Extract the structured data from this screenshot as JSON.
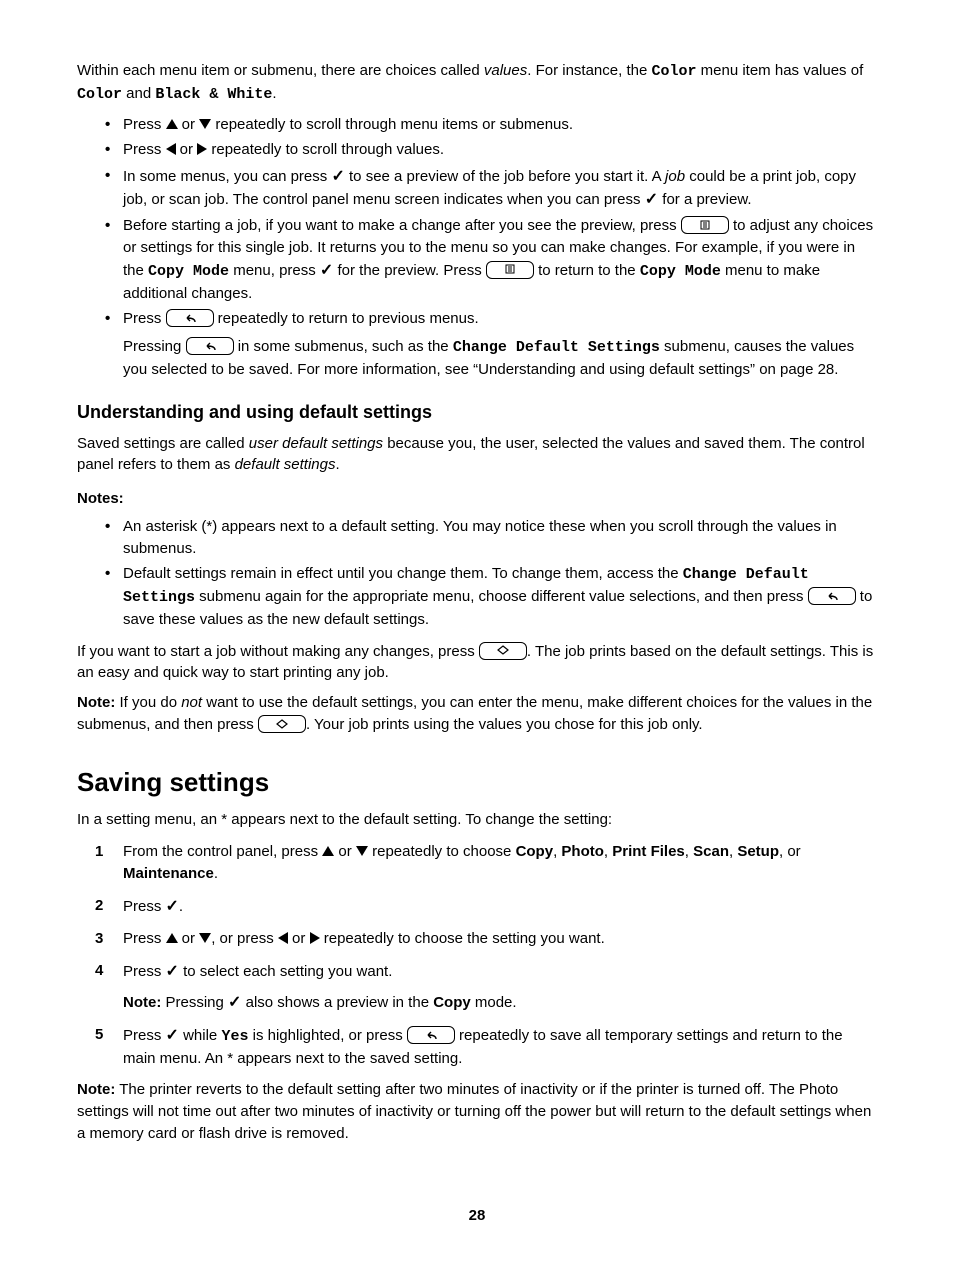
{
  "intro": {
    "p1a": "Within each menu item or submenu, there are choices called ",
    "p1b": "values",
    "p1c": ". For instance, the ",
    "p1d": "Color",
    "p1e": " menu item has values of ",
    "p1f": "Color",
    "p1g": " and ",
    "p1h": "Black & White",
    "p1i": "."
  },
  "bullets1": {
    "b1a": "Press ",
    "b1b": " or ",
    "b1c": " repeatedly to scroll through menu items or submenus.",
    "b2a": "Press ",
    "b2b": " or ",
    "b2c": " repeatedly to scroll through values.",
    "b3a": "In some menus, you can press ",
    "b3b": " to see a preview of the job before you start it. A ",
    "b3c": "job",
    "b3d": " could be a print job, copy job, or scan job. The control panel menu screen indicates when you can press ",
    "b3e": " for a preview.",
    "b4a": "Before starting a job, if you want to make a change after you see the preview, press ",
    "b4b": " to adjust any choices or settings for this single job. It returns you to the menu so you can make changes. For example, if you were in the ",
    "b4c": "Copy Mode",
    "b4d": " menu, press ",
    "b4e": " for the preview. Press ",
    "b4f": " to return to the ",
    "b4g": "Copy Mode",
    "b4h": " menu to make additional changes.",
    "b5a": "Press ",
    "b5b": " repeatedly to return to previous menus.",
    "b5c": "Pressing ",
    "b5d": " in some submenus, such as the ",
    "b5e": "Change Default Settings",
    "b5f": " submenu, causes the values you selected to be saved. For more information, see “Understanding and using default settings” on page 28."
  },
  "heading_defaults": "Understanding and using default settings",
  "defaults": {
    "p1a": "Saved settings are called ",
    "p1b": "user default settings",
    "p1c": " because you, the user, selected the values and saved them. The control panel refers to them as ",
    "p1d": "default settings",
    "p1e": "."
  },
  "notes_label": "Notes:",
  "notes": {
    "n1": "An asterisk (*) appears next to a default setting. You may notice these when you scroll through the values in submenus.",
    "n2a": "Default settings remain in effect until you change them. To change them, access the ",
    "n2b": "Change Default Settings",
    "n2c": " submenu again for the appropriate menu, choose different value selections, and then press ",
    "n2d": " to save these values as the new default settings."
  },
  "defaults2": {
    "p1a": "If you want to start a job without making any changes, press ",
    "p1b": ". The job prints based on the default settings. This is an easy and quick way to start printing any job.",
    "p2a": "Note:",
    "p2b": " If you do ",
    "p2c": "not",
    "p2d": " want to use the default settings, you can enter the menu, make different choices for the values in the submenus, and then press ",
    "p2e": ". Your job prints using the values you chose for this job only."
  },
  "heading_saving": "Saving settings",
  "saving_intro": "In a setting menu, an * appears next to the default setting. To change the setting:",
  "steps": {
    "s1a": "From the control panel, press ",
    "s1b": " or ",
    "s1c": " repeatedly to choose ",
    "s1d": "Copy",
    "s1e": ", ",
    "s1f": "Photo",
    "s1g": ", ",
    "s1h": "Print Files",
    "s1i": ", ",
    "s1j": "Scan",
    "s1k": ", ",
    "s1l": "Setup",
    "s1m": ", or ",
    "s1n": "Maintenance",
    "s1o": ".",
    "s2a": "Press ",
    "s2b": ".",
    "s3a": "Press ",
    "s3b": " or ",
    "s3c": ", or press ",
    "s3d": " or ",
    "s3e": " repeatedly to choose the setting you want.",
    "s4a": "Press ",
    "s4b": " to select each setting you want.",
    "s4note_a": "Note:",
    "s4note_b": " Pressing ",
    "s4note_c": " also shows a preview in the ",
    "s4note_d": "Copy",
    "s4note_e": " mode.",
    "s5a": "Press ",
    "s5b": " while ",
    "s5c": "Yes",
    "s5d": " is highlighted, or press ",
    "s5e": " repeatedly to save all temporary settings and return to the main menu. An * appears next to the saved setting."
  },
  "final_note_a": "Note:",
  "final_note_b": " The printer reverts to the default setting after two minutes of inactivity or if the printer is turned off. The Photo settings will not time out after two minutes of inactivity or turning off the power but will return to the default settings when a memory card or flash drive is removed.",
  "pagenum": "28"
}
